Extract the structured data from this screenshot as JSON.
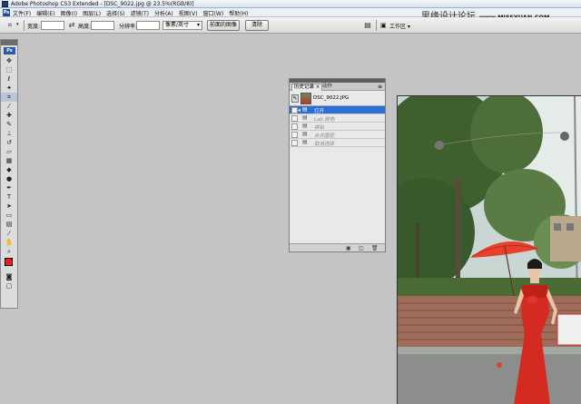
{
  "window": {
    "title": "Adobe Photoshop CS3 Extended - [DSC_9022.jpg @ 23.5%(RGB/8)]"
  },
  "watermark": {
    "text": "思缘设计论坛",
    "url": "www.MISSYUAN.COM"
  },
  "menubar": {
    "logo": "Ps",
    "items": [
      "文件(F)",
      "编辑(E)",
      "图像(I)",
      "图层(L)",
      "选择(S)",
      "滤镜(T)",
      "分析(A)",
      "视图(V)",
      "窗口(W)",
      "帮助(H)"
    ]
  },
  "options": {
    "width_label": "宽度:",
    "width_value": "",
    "height_label": "高度:",
    "height_value": "",
    "resolution_label": "分辨率:",
    "resolution_value": "",
    "resolution_unit": "像素/英寸",
    "front_image_button": "前面的图像",
    "clear_button": "清除",
    "workspace_label": "工作区"
  },
  "toolbox": {
    "badge": "Ps",
    "foreground_color": "#ee1c1c",
    "background_color": "#ffffff"
  },
  "history_panel": {
    "tab_history": "历史记录",
    "tab_actions": "动作",
    "snapshot_name": "DSC_9022.JPG",
    "items": [
      {
        "label": "打开",
        "active": true
      },
      {
        "label": "Lab 颜色",
        "active": false
      },
      {
        "label": "拼贴",
        "active": false
      },
      {
        "label": "合并图层",
        "active": false
      },
      {
        "label": "取消选择",
        "active": false
      }
    ]
  },
  "colors": {
    "workspace_bg": "#c4c4c4",
    "history_selected": "#2b6fd6",
    "dress": "#d42a22",
    "umbrella": "#e8402c"
  }
}
